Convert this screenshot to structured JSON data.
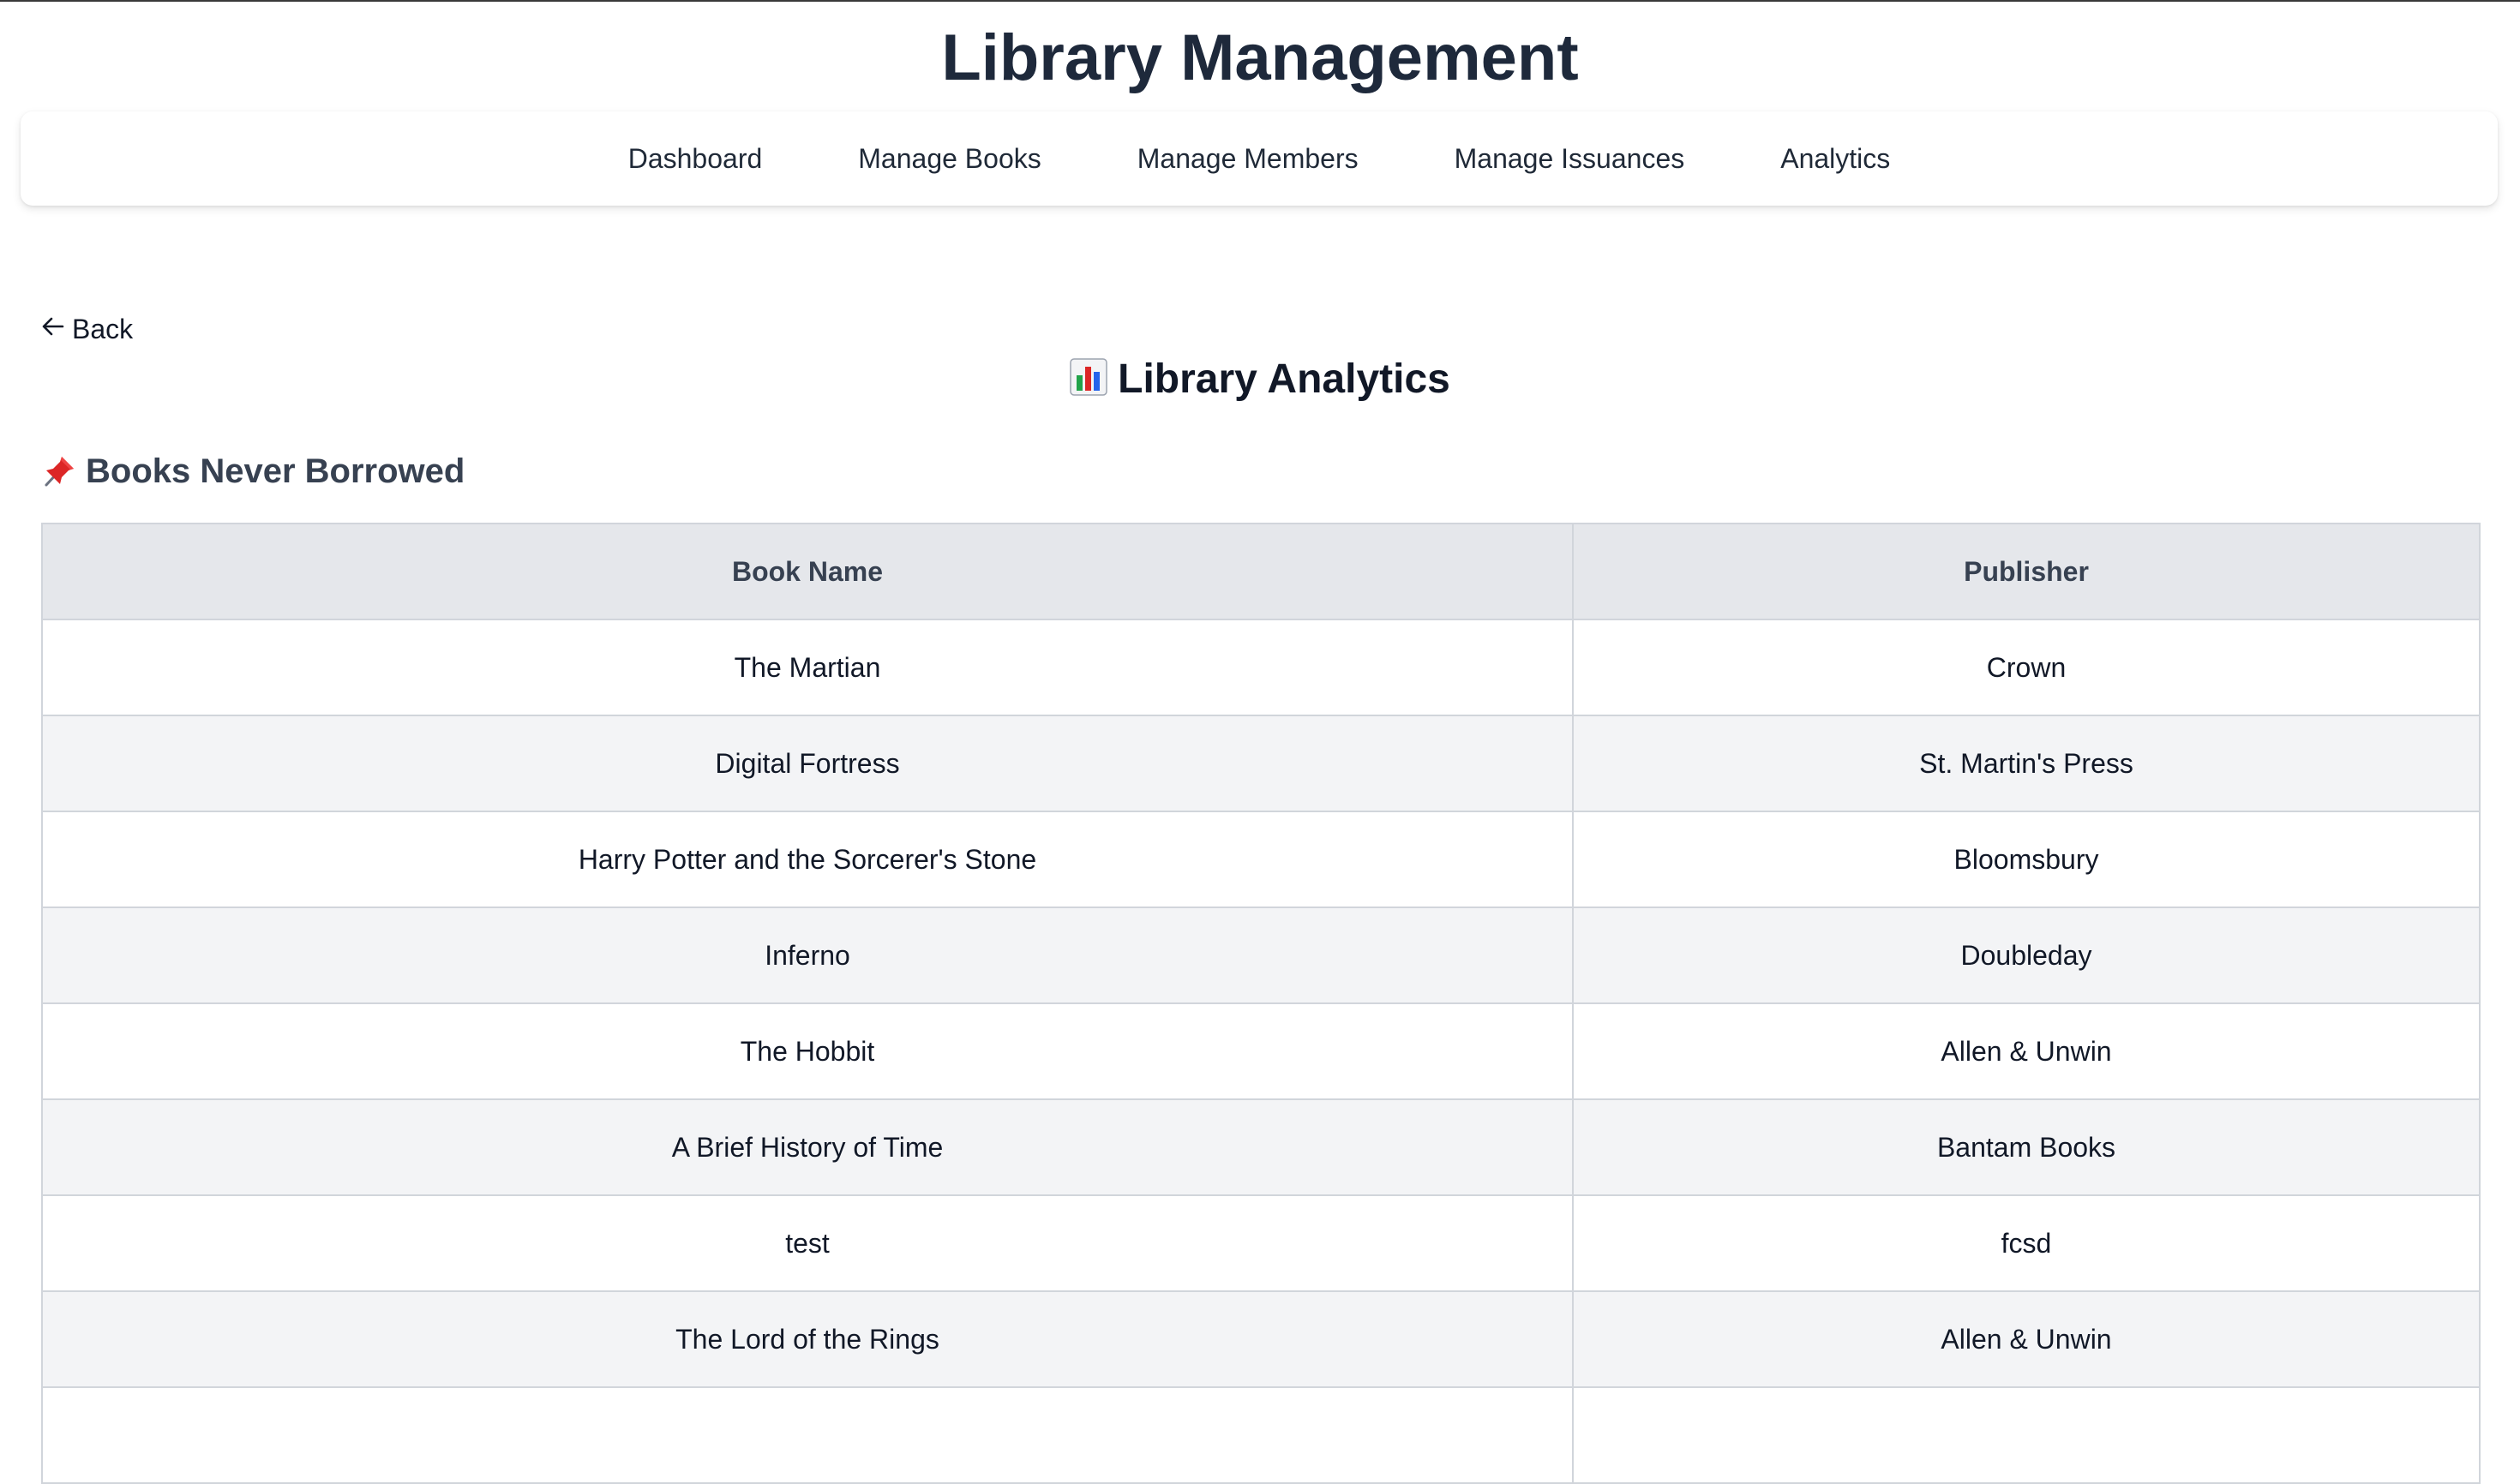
{
  "header": {
    "app_title": "Library Management"
  },
  "nav": {
    "items": [
      {
        "label": "Dashboard"
      },
      {
        "label": "Manage Books"
      },
      {
        "label": "Manage Members"
      },
      {
        "label": "Manage Issuances"
      },
      {
        "label": "Analytics"
      }
    ]
  },
  "back": {
    "label": "Back",
    "icon": "arrow-left-icon"
  },
  "page": {
    "title": "Library Analytics",
    "title_icon": "bar-chart-icon"
  },
  "section": {
    "title": "Books Never Borrowed",
    "icon": "pushpin-icon"
  },
  "table": {
    "headers": [
      "Book Name",
      "Publisher"
    ],
    "rows": [
      {
        "book": "The Martian",
        "publisher": "Crown"
      },
      {
        "book": "Digital Fortress",
        "publisher": "St. Martin's Press"
      },
      {
        "book": "Harry Potter and the Sorcerer's Stone",
        "publisher": "Bloomsbury"
      },
      {
        "book": "Inferno",
        "publisher": "Doubleday"
      },
      {
        "book": "The Hobbit",
        "publisher": "Allen & Unwin"
      },
      {
        "book": "A Brief History of Time",
        "publisher": "Bantam Books"
      },
      {
        "book": "test",
        "publisher": "fcsd"
      },
      {
        "book": "The Lord of the Rings",
        "publisher": "Allen & Unwin"
      },
      {
        "book": "",
        "publisher": ""
      }
    ]
  },
  "colors": {
    "title": "#1e293b",
    "header_bg": "#e5e7eb",
    "stripe_bg": "#f3f4f6",
    "border": "#d1d5db"
  }
}
